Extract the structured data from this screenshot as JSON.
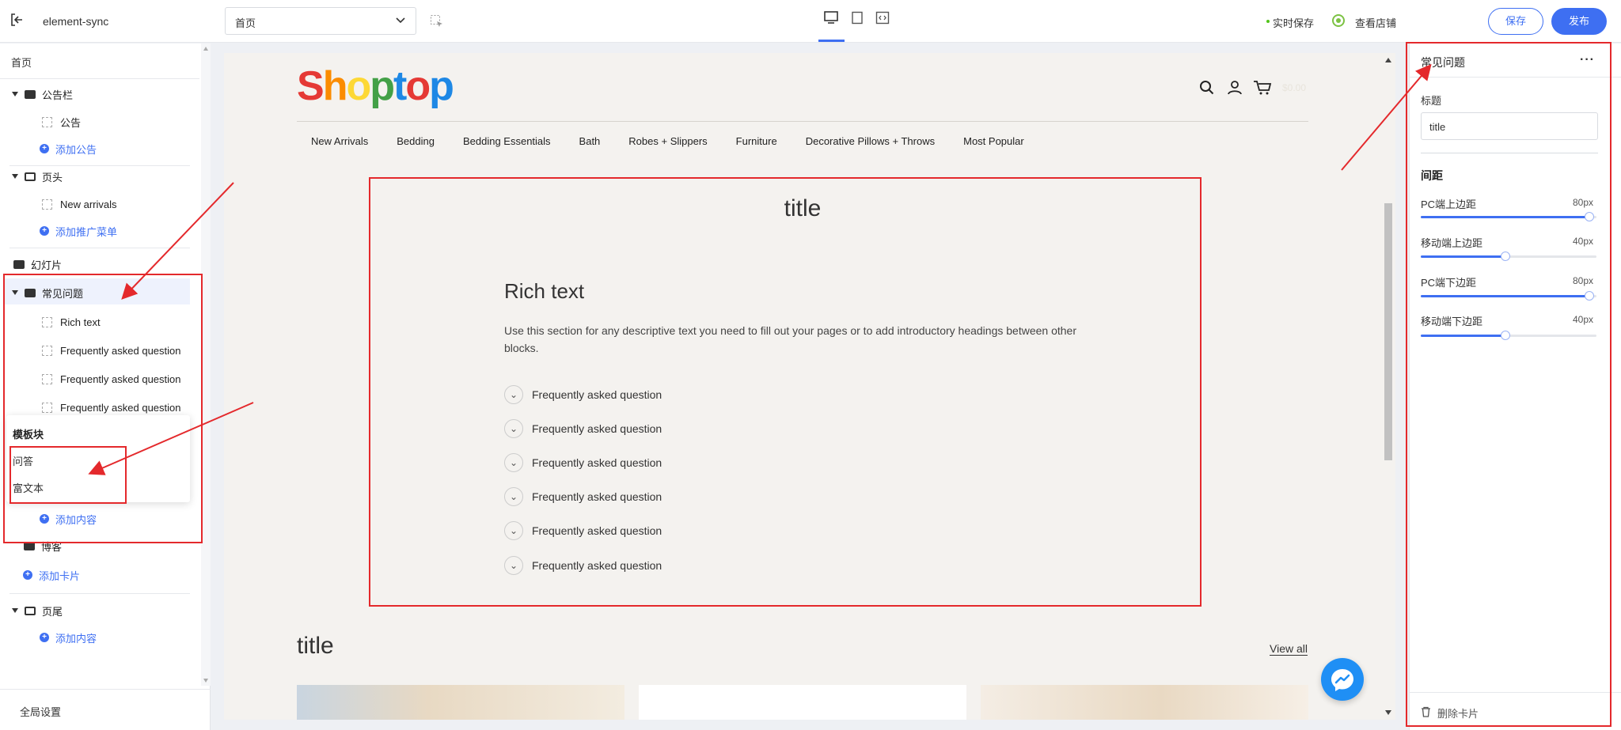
{
  "topbar": {
    "app_name": "element-sync",
    "page_select": "首页",
    "autosave": "实时保存",
    "view_store": "查看店铺",
    "save_label": "保存",
    "publish_label": "发布"
  },
  "sidebar": {
    "page_title": "首页",
    "announcement_section": "公告栏",
    "announcement_item": "公告",
    "add_announcement": "添加公告",
    "header_section": "页头",
    "header_item": "New arrivals",
    "add_promo_menu": "添加推广菜单",
    "slideshow_section": "幻灯片",
    "faq_section": "常见问题",
    "faq_items": [
      "Rich text",
      "Frequently asked question",
      "Frequently asked question",
      "Frequently asked question"
    ],
    "popup_title": "模板块",
    "popup_items": [
      "问答",
      "富文本"
    ],
    "add_content": "添加内容",
    "blog_section": "博客",
    "add_card": "添加卡片",
    "footer_section": "页尾",
    "add_footer_content": "添加内容",
    "global_settings": "全局设置"
  },
  "store": {
    "logo": "Shoptop",
    "cart_total": "$0.00",
    "nav": [
      "New Arrivals",
      "Bedding",
      "Bedding Essentials",
      "Bath",
      "Robes + Slippers",
      "Furniture",
      "Decorative Pillows + Throws",
      "Most Popular"
    ],
    "section_title": "title",
    "rich_text_heading": "Rich text",
    "rich_text_body": "Use this section for any descriptive text you need to fill out your pages or to add introductory headings between other blocks.",
    "faq_questions": [
      "Frequently asked question",
      "Frequently asked question",
      "Frequently asked question",
      "Frequently asked question",
      "Frequently asked question",
      "Frequently asked question"
    ],
    "next_title": "title",
    "view_all": "View all"
  },
  "panel": {
    "title": "常见问题",
    "label_title": "标题",
    "title_value": "title",
    "spacing_heading": "间距",
    "sliders": [
      {
        "label": "PC端上边距",
        "value_text": "80px",
        "fraction": 0.96
      },
      {
        "label": "移动端上边距",
        "value_text": "40px",
        "fraction": 0.48
      },
      {
        "label": "PC端下边距",
        "value_text": "80px",
        "fraction": 0.96
      },
      {
        "label": "移动端下边距",
        "value_text": "40px",
        "fraction": 0.48
      }
    ],
    "delete_card": "删除卡片"
  },
  "colors": {
    "accent": "#3e6ff2",
    "annotation": "#e4292c",
    "messenger": "#1f8ff5"
  }
}
